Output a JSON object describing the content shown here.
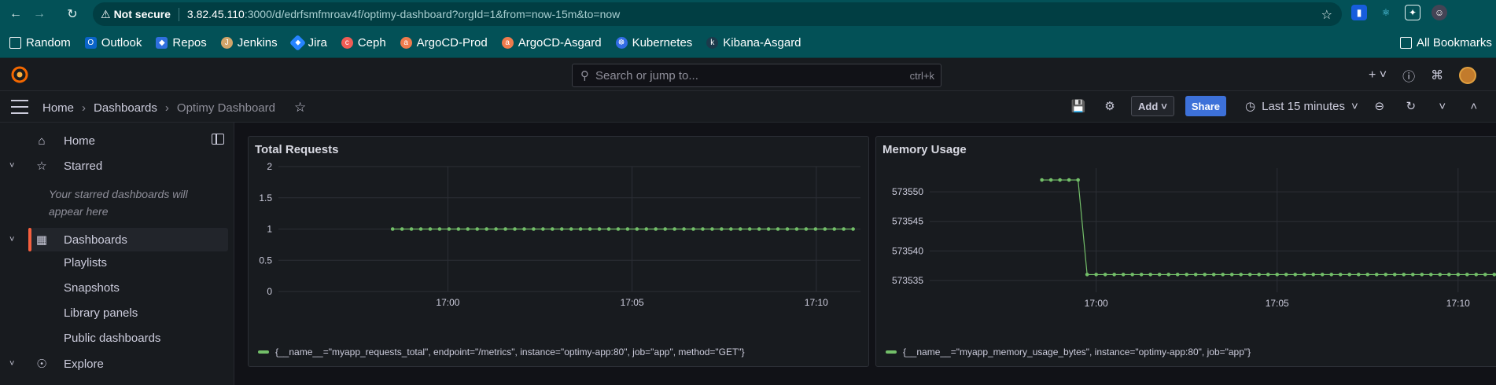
{
  "browser": {
    "security_label": "Not secure",
    "url_host": "3.82.45.110",
    "url_rest": ":3000/d/edrfsmfmroav4f/optimy-dashboard?orgId=1&from=now-15m&to=now",
    "bookmarks": [
      "Random",
      "Outlook",
      "Repos",
      "Jenkins",
      "Jira",
      "Ceph",
      "ArgoCD-Prod",
      "ArgoCD-Asgard",
      "Kubernetes",
      "Kibana-Asgard"
    ],
    "all_bookmarks": "All Bookmarks"
  },
  "topbar": {
    "search_placeholder": "Search or jump to...",
    "search_shortcut": "ctrl+k",
    "new_label": "+"
  },
  "breadcrumbs": {
    "home": "Home",
    "dashboards": "Dashboards",
    "current": "Optimy Dashboard"
  },
  "toolbar": {
    "add_label": "Add",
    "share_label": "Share",
    "time_range": "Last 15 minutes"
  },
  "sidebar": {
    "home": "Home",
    "starred": "Starred",
    "starred_note": "Your starred dashboards will appear here",
    "dashboards": "Dashboards",
    "playlists": "Playlists",
    "snapshots": "Snapshots",
    "library_panels": "Library panels",
    "public_dashboards": "Public dashboards",
    "explore": "Explore"
  },
  "colors": {
    "accent": "#f55f3e",
    "series": "#73bf69",
    "share_button": "#3d71d9"
  },
  "panels": [
    {
      "title": "Total Requests",
      "legend": "{__name__=\"myapp_requests_total\", endpoint=\"/metrics\", instance=\"optimy-app:80\", job=\"app\", method=\"GET\"}"
    },
    {
      "title": "Memory Usage",
      "legend": "{__name__=\"myapp_memory_usage_bytes\", instance=\"optimy-app:80\", job=\"app\"}"
    }
  ],
  "chart_data": [
    {
      "type": "line",
      "title": "Total Requests",
      "xlabel": "",
      "ylabel": "",
      "x_ticks": [
        "17:00",
        "17:05",
        "17:10"
      ],
      "y_ticks": [
        "0",
        "0.5",
        "1",
        "1.5",
        "2"
      ],
      "ylim": [
        0,
        2
      ],
      "xlim": [
        "16:55:24",
        "17:11:12"
      ],
      "grid": true,
      "legend_position": "bottom-left",
      "series": [
        {
          "name": "{__name__=\"myapp_requests_total\", endpoint=\"/metrics\", instance=\"optimy-app:80\", job=\"app\", method=\"GET\"}",
          "x_start": "16:58:30",
          "x_end": "17:11:00",
          "points": 50,
          "value": 1
        }
      ]
    },
    {
      "type": "line",
      "title": "Memory Usage",
      "xlabel": "",
      "ylabel": "",
      "x_ticks": [
        "17:00",
        "17:05",
        "17:10"
      ],
      "y_ticks": [
        "573535",
        "573540",
        "573545",
        "573550"
      ],
      "ylim": [
        573533,
        573554
      ],
      "xlim": [
        "16:55:24",
        "17:11:12"
      ],
      "grid": true,
      "legend_position": "bottom-left",
      "series": [
        {
          "name": "{__name__=\"myapp_memory_usage_bytes\", instance=\"optimy-app:80\", job=\"app\"}",
          "segments": [
            {
              "x_start": "16:58:30",
              "x_end": "16:59:30",
              "points": 5,
              "value": 573552
            },
            {
              "x_start": "16:59:45",
              "x_end": "17:11:15",
              "points": 47,
              "value": 573536
            }
          ]
        }
      ]
    }
  ]
}
